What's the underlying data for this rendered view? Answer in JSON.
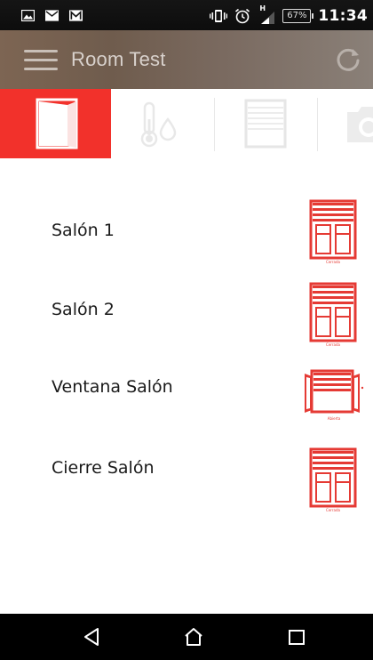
{
  "status_bar": {
    "icons_left": [
      "image-icon",
      "mail-icon",
      "gmail-icon"
    ],
    "icons_right": [
      "vibrate-icon",
      "alarm-icon",
      "signal-icon"
    ],
    "network_type": "H",
    "battery": "67%",
    "time": "11:34"
  },
  "app_bar": {
    "title": "Room Test",
    "menu_icon": "hamburger-icon",
    "action_icon": "refresh-icon"
  },
  "tabs": [
    {
      "name": "windows",
      "icon": "window-door-icon",
      "active": true
    },
    {
      "name": "climate",
      "icon": "thermometer-drop-icon",
      "active": false
    },
    {
      "name": "blinds",
      "icon": "blind-icon",
      "active": false
    },
    {
      "name": "camera",
      "icon": "camera-icon",
      "active": false
    }
  ],
  "devices": [
    {
      "label": "Salón 1",
      "status": "Cerrada",
      "icon": "closed-shutter-window-icon"
    },
    {
      "label": "Salón 2",
      "status": "Cerrada",
      "icon": "closed-shutter-window-icon"
    },
    {
      "label": "Ventana Salón",
      "status": "Abierta",
      "icon": "open-shutter-window-icon"
    },
    {
      "label": "Cierre Salón",
      "status": "Cerrada",
      "icon": "closed-shutter-window-icon"
    }
  ],
  "colors": {
    "accent": "#f2312b",
    "app_bar": "#7a6555",
    "status_bar": "#111111",
    "nav_bar": "#000000"
  },
  "nav_bar": {
    "buttons": [
      "back-icon",
      "home-icon",
      "recents-icon"
    ]
  }
}
